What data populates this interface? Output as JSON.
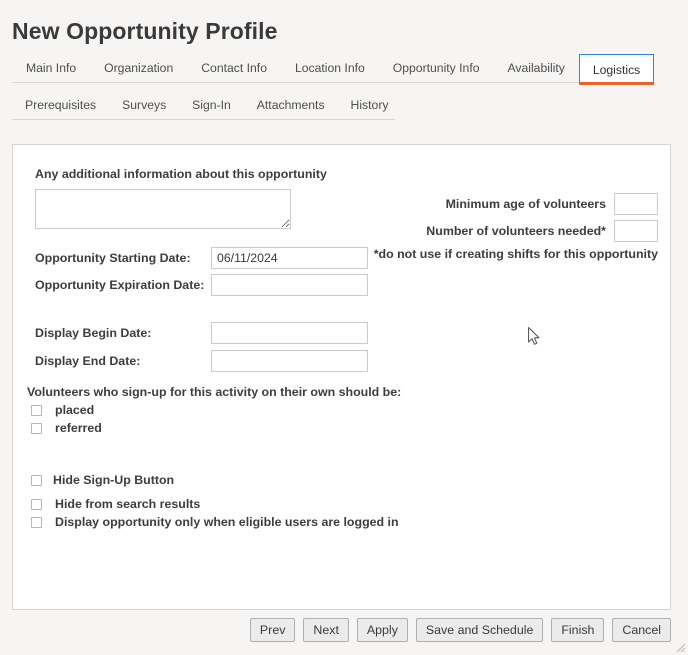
{
  "header": {
    "title": "New Opportunity Profile"
  },
  "primary_tabs": [
    {
      "label": "Main Info",
      "active": false
    },
    {
      "label": "Organization",
      "active": false
    },
    {
      "label": "Contact Info",
      "active": false
    },
    {
      "label": "Location Info",
      "active": false
    },
    {
      "label": "Opportunity Info",
      "active": false
    },
    {
      "label": "Availability",
      "active": false
    },
    {
      "label": "Logistics",
      "active": true
    }
  ],
  "secondary_tabs": [
    {
      "label": "Prerequisites"
    },
    {
      "label": "Surveys"
    },
    {
      "label": "Sign-In"
    },
    {
      "label": "Attachments"
    },
    {
      "label": "History"
    }
  ],
  "form": {
    "notes_label": "Any additional information about this opportunity",
    "notes_value": "",
    "notes_placeholder": "",
    "dates": [
      {
        "label": "Opportunity Starting Date:",
        "value": "06/11/2024"
      },
      {
        "label": "Opportunity Expiration Date:",
        "value": ""
      },
      {
        "label": "Display Begin Date:",
        "value": ""
      },
      {
        "label": "Display End Date:",
        "value": ""
      }
    ],
    "right_fields": [
      {
        "label": "Minimum age of volunteers",
        "value": ""
      },
      {
        "label": "Number of volunteers needed*",
        "value": ""
      }
    ],
    "right_note": "*do not use if creating shifts for this opportunity",
    "signup_heading": "Volunteers who sign-up for this activity on their own should be:",
    "signup_options": [
      {
        "label": "placed",
        "checked": false
      },
      {
        "label": "referred",
        "checked": false
      }
    ],
    "visibility_options": [
      {
        "label": "Hide Sign-Up Button",
        "checked": false
      },
      {
        "label": "Hide from search results",
        "checked": false
      },
      {
        "label": "Display opportunity only when eligible users are logged in",
        "checked": false
      }
    ]
  },
  "buttons": [
    {
      "label": "Prev"
    },
    {
      "label": "Next"
    },
    {
      "label": "Apply"
    },
    {
      "label": "Save and Schedule"
    },
    {
      "label": "Finish"
    },
    {
      "label": "Cancel"
    }
  ],
  "colors": {
    "accent_orange": "#e8642a",
    "accent_blue": "#2e87d6",
    "page_background": "#f6f5f4",
    "panel_background": "#ffffff",
    "text": "#3d3d3d"
  }
}
